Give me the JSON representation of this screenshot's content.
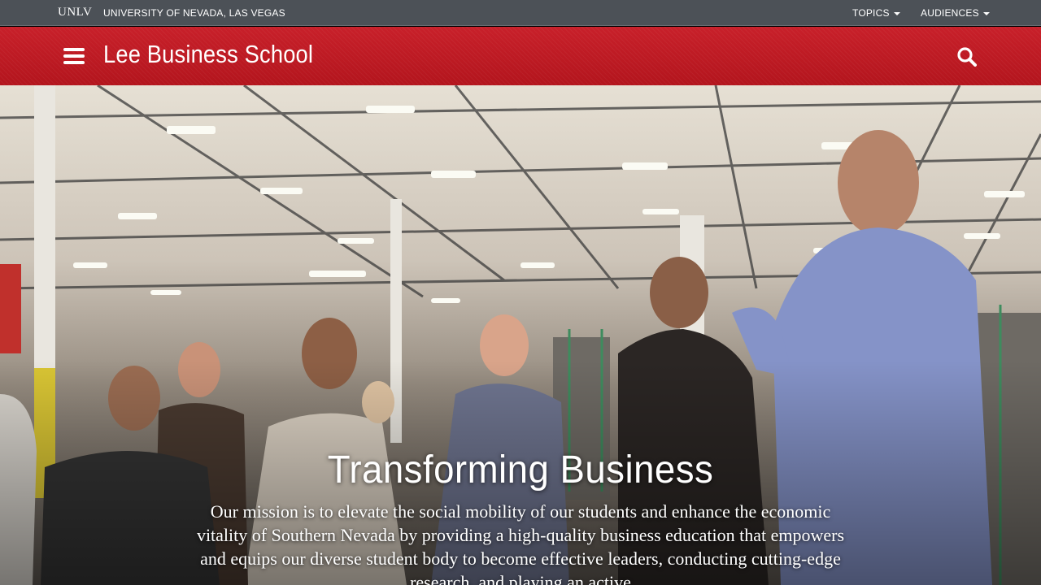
{
  "utility_bar": {
    "logo_text": "UNLV",
    "university_name": "UNIVERSITY OF NEVADA, LAS VEGAS",
    "menus": [
      {
        "label": "TOPICS"
      },
      {
        "label": "AUDIENCES"
      }
    ]
  },
  "header": {
    "site_title": "Lee Business School",
    "menu_icon": "hamburger-menu-icon",
    "search_icon": "search-icon",
    "brand_color": "#c41e26"
  },
  "hero": {
    "title": "Transforming Business",
    "mission": "Our mission is to elevate the social mobility of our students and enhance the economic vitality of Southern Nevada by providing a high-quality business education that empowers and equips our diverse student body to become effective leaders, conducting cutting-edge research, and playing an active"
  },
  "colors": {
    "utility_bar": "#4c5157",
    "header_red": "#c41e26",
    "text_white": "#ffffff"
  }
}
